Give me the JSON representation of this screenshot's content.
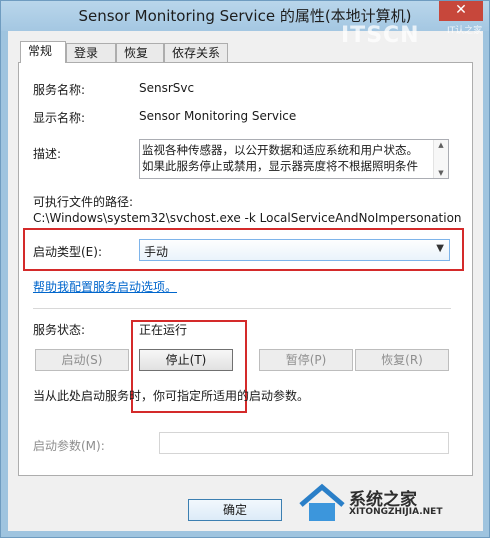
{
  "window": {
    "title": "Sensor Monitoring Service 的属性(本地计算机)",
    "close_glyph": "✕"
  },
  "tabs": [
    {
      "label": "常规"
    },
    {
      "label": "登录"
    },
    {
      "label": "恢复"
    },
    {
      "label": "依存关系"
    }
  ],
  "general": {
    "service_name_label": "服务名称:",
    "service_name_value": "SensrSvc",
    "display_name_label": "显示名称:",
    "display_name_value": "Sensor Monitoring Service",
    "description_label": "描述:",
    "description_value": "监视各种传感器，以公开数据和适应系统和用户状态。\n如果此服务停止或禁用，显示器亮度将不根据照明条件",
    "exe_path_label": "可执行文件的路径:",
    "exe_path_value": "C:\\Windows\\system32\\svchost.exe -k LocalServiceAndNoImpersonation",
    "startup_type_label": "启动类型(E):",
    "startup_type_value": "手动",
    "help_link": "帮助我配置服务启动选项。",
    "status_label": "服务状态:",
    "status_value": "正在运行",
    "buttons": {
      "start": "启动(S)",
      "stop": "停止(T)",
      "pause": "暂停(P)",
      "resume": "恢复(R)"
    },
    "start_hint": "当从此处启动服务时，你可指定所适用的启动参数。",
    "start_params_label": "启动参数(M):",
    "start_params_value": ""
  },
  "footer": {
    "ok_label": "确定"
  },
  "watermarks": {
    "top_text": "ITSCN",
    "top_sub": "IT认之家",
    "bottom_cn": "系统之家",
    "bottom_en": "XITONGZHIJIA.NET"
  },
  "colors": {
    "highlight_box": "#d42a2a",
    "link": "#0066cc",
    "titlebar": "#a4c7e2",
    "close_button": "#c7473b"
  },
  "icons": {
    "dropdown": "chevron-down-icon",
    "close": "close-icon",
    "scroll_up": "scroll-up-icon",
    "scroll_down": "scroll-down-icon"
  }
}
